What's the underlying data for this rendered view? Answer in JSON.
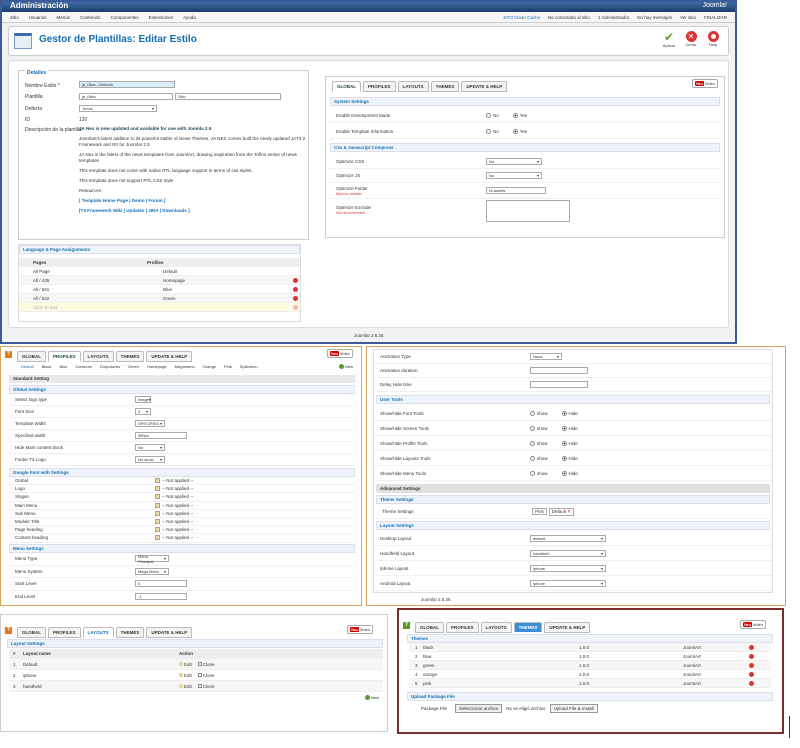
{
  "topbar": {
    "title": "Administración",
    "brand": "Joomla!"
  },
  "menu": {
    "items": [
      "Sitio",
      "Usuarios",
      "Menús",
      "Contenido",
      "Componentes",
      "Extensiones",
      "Ayuda"
    ]
  },
  "status": {
    "items": [
      "JAT3 Clean Cache",
      "No conectado al sitio",
      "1 Administrador",
      "No hay mensajes",
      "Ver sitio",
      "FINALIZAR"
    ]
  },
  "toolbar": {
    "title": "Gestor de Plantillas: Editar Estilo",
    "apply": "Aplicar",
    "close": "Cerrar",
    "help": "Help"
  },
  "details": {
    "legend": "Detalles",
    "style_label": "Nombre Estilo *",
    "style_value": "ja_t3ws - Defecto",
    "template_label": "Plantilla",
    "template_value": "ja_t3ws",
    "site_value": "Sitio",
    "default_label": "Defecto",
    "default_value": "Todos",
    "id_label": "ID",
    "id_value": "120",
    "desc_label": "Descripción de la plantilla",
    "desc1": "JA Nex is now updated and available for use with Joomla 2.5",
    "desc2": "Joomlart's latest addition to its powerful stable of News Themes, JA NEX comes built the newly updated JAT3 2 Framework and R2 for Joomla! 2.5",
    "desc3": "JA Nex is the latest of the news templates from JoomlArt, drawing inspiration from the Tofino series of news templates",
    "desc4": "This template does not come with native RTL language support in terms of css styles.",
    "desc5": "This template does not support RTL CSS style",
    "resources": "Resources :",
    "links1": "[ Template Home Page | Demo | Forum ]",
    "links2": "[T3 Framework Wiki | Updates | JIRA | Downloads ]"
  },
  "assign": {
    "title": "Language & Page Assignments",
    "headers": [
      "Pages",
      "Profiles"
    ],
    "rows": [
      [
        "All Page",
        "Default"
      ],
      [
        "All / 435",
        "Homepage"
      ],
      [
        "All / 631",
        "Blue"
      ],
      [
        "All / 632",
        "Green"
      ],
      [
        "Click To add",
        ""
      ]
    ]
  },
  "global": {
    "tabs": [
      "GLOBAL",
      "PROFILES",
      "LAYOUTS",
      "THEMES",
      "UPDATE & HELP"
    ],
    "video": "Video",
    "system_title": "System Settings",
    "dev_label": "Enable Development Mode",
    "tmplinfo_label": "Enable Template Information",
    "no": "No",
    "yes": "Yes",
    "css_title": "Css & Javascript Compress",
    "ocss_label": "Optimize CSS",
    "ocss_value": "No",
    "ojs_label": "Optimize JS",
    "ojs_value": "No",
    "ofolder_label": "Optimize Folder",
    "ofolder_note": "Must be writable",
    "ofolder_value": "t3-assets",
    "oexcl_label": "Optimize Exclude",
    "oexcl_note": "Not recommended"
  },
  "footer1": "Joomla! 2.5.25",
  "profiles": {
    "tabs": [
      "GLOBAL",
      "PROFILES",
      "LAYOUTS",
      "THEMES",
      "UPDATE & HELP"
    ],
    "subtabs": [
      "Default",
      "Black",
      "Blue",
      "Cameras",
      "Dropdowns",
      "Green",
      "Homepage",
      "Megamenu",
      "Orange",
      "Pink",
      "Splitmenu"
    ],
    "new": "New",
    "std": "Standard Setting",
    "global_sec": "Global Settings",
    "rows": [
      [
        "Select logo type",
        "image"
      ],
      [
        "Font Size",
        "3"
      ],
      [
        "Template Width",
        "SPECIFIED"
      ],
      [
        "Specified width",
        "980px"
      ],
      [
        "Hide Main content block",
        "No"
      ],
      [
        "Footer T3 Logo",
        "No show"
      ]
    ],
    "gfont_sec": "Google Font with Settings",
    "fonts": [
      "Global",
      "Logo",
      "Slogan",
      "Main Menu",
      "Sub Menu",
      "Module Title",
      "Page heading",
      "Content heading"
    ],
    "not_applied": "-- Not applied --",
    "menu_sec": "Menu Settings",
    "menu_rows": [
      [
        "Menu Type",
        "Menu Principal"
      ],
      [
        "Menu System",
        "Mega Menu"
      ],
      [
        "Start Level",
        "0"
      ],
      [
        "End Level",
        "-1"
      ]
    ]
  },
  "adv": {
    "anim_rows": [
      [
        "Animation Type",
        "None"
      ],
      [
        "Animation duration",
        ""
      ],
      [
        "Delay Hide time",
        ""
      ]
    ],
    "user_sec": "User Tools",
    "tools": [
      "Show/Hide Font Tools",
      "Show/Hide Screen Tools",
      "Show/Hide Profile Tools",
      "Show/Hide Layouts Tools",
      "Show/Hide Menu Tools"
    ],
    "show": "show",
    "hide": "Hide",
    "adv_title": "Advanced Settings",
    "theme_sec": "Theme Settings",
    "theme_label": "Theme Settings",
    "theme_values": [
      "Pink",
      "Default"
    ],
    "layout_sec": "Layout Settings",
    "layouts": [
      [
        "Desktop Layout",
        "default"
      ],
      [
        "Handheld Layout",
        "handheld"
      ],
      [
        "Iphone Layout",
        "iphone"
      ],
      [
        "Android Layout",
        "iphone"
      ]
    ],
    "footer": "Joomla! 2.5.25"
  },
  "layouts_panel": {
    "tabs": [
      "GLOBAL",
      "PROFILES",
      "LAYOUTS",
      "THEMES",
      "UPDATE & HELP"
    ],
    "sec": "Layout Settings",
    "headers": [
      "#",
      "Layout name",
      "Action"
    ],
    "rows": [
      [
        "1",
        "Default"
      ],
      [
        "2",
        "iphone"
      ],
      [
        "3",
        "handheld"
      ]
    ],
    "edit": "Edit",
    "clone": "Clone",
    "new": "New"
  },
  "themes_panel": {
    "tabs": [
      "GLOBAL",
      "PROFILES",
      "LAYOUTS",
      "THEMES",
      "UPDATE & HELP"
    ],
    "sec": "Themes",
    "rows": [
      [
        "1",
        "black",
        "1.0.0",
        "JoomlArt"
      ],
      [
        "2",
        "blue",
        "1.0.0",
        "JoomlArt"
      ],
      [
        "3",
        "green",
        "1.0.0",
        "JoomlArt"
      ],
      [
        "4",
        "orange",
        "1.0.0",
        "JoomlArt"
      ],
      [
        "5",
        "pink",
        "1.0.0",
        "JoomlArt"
      ]
    ],
    "upload_sec": "Upload Package File",
    "pkg_label": "Package File",
    "browse": "Seleccionar archivo",
    "nofile": "No se eligió archivo",
    "upload": "Upload File & Install"
  },
  "colors": {
    "accent": "#146eb4",
    "blue_frame": "#3b5a9a",
    "orange_frame": "#d9a55b",
    "red_frame": "#7a2b2b"
  }
}
